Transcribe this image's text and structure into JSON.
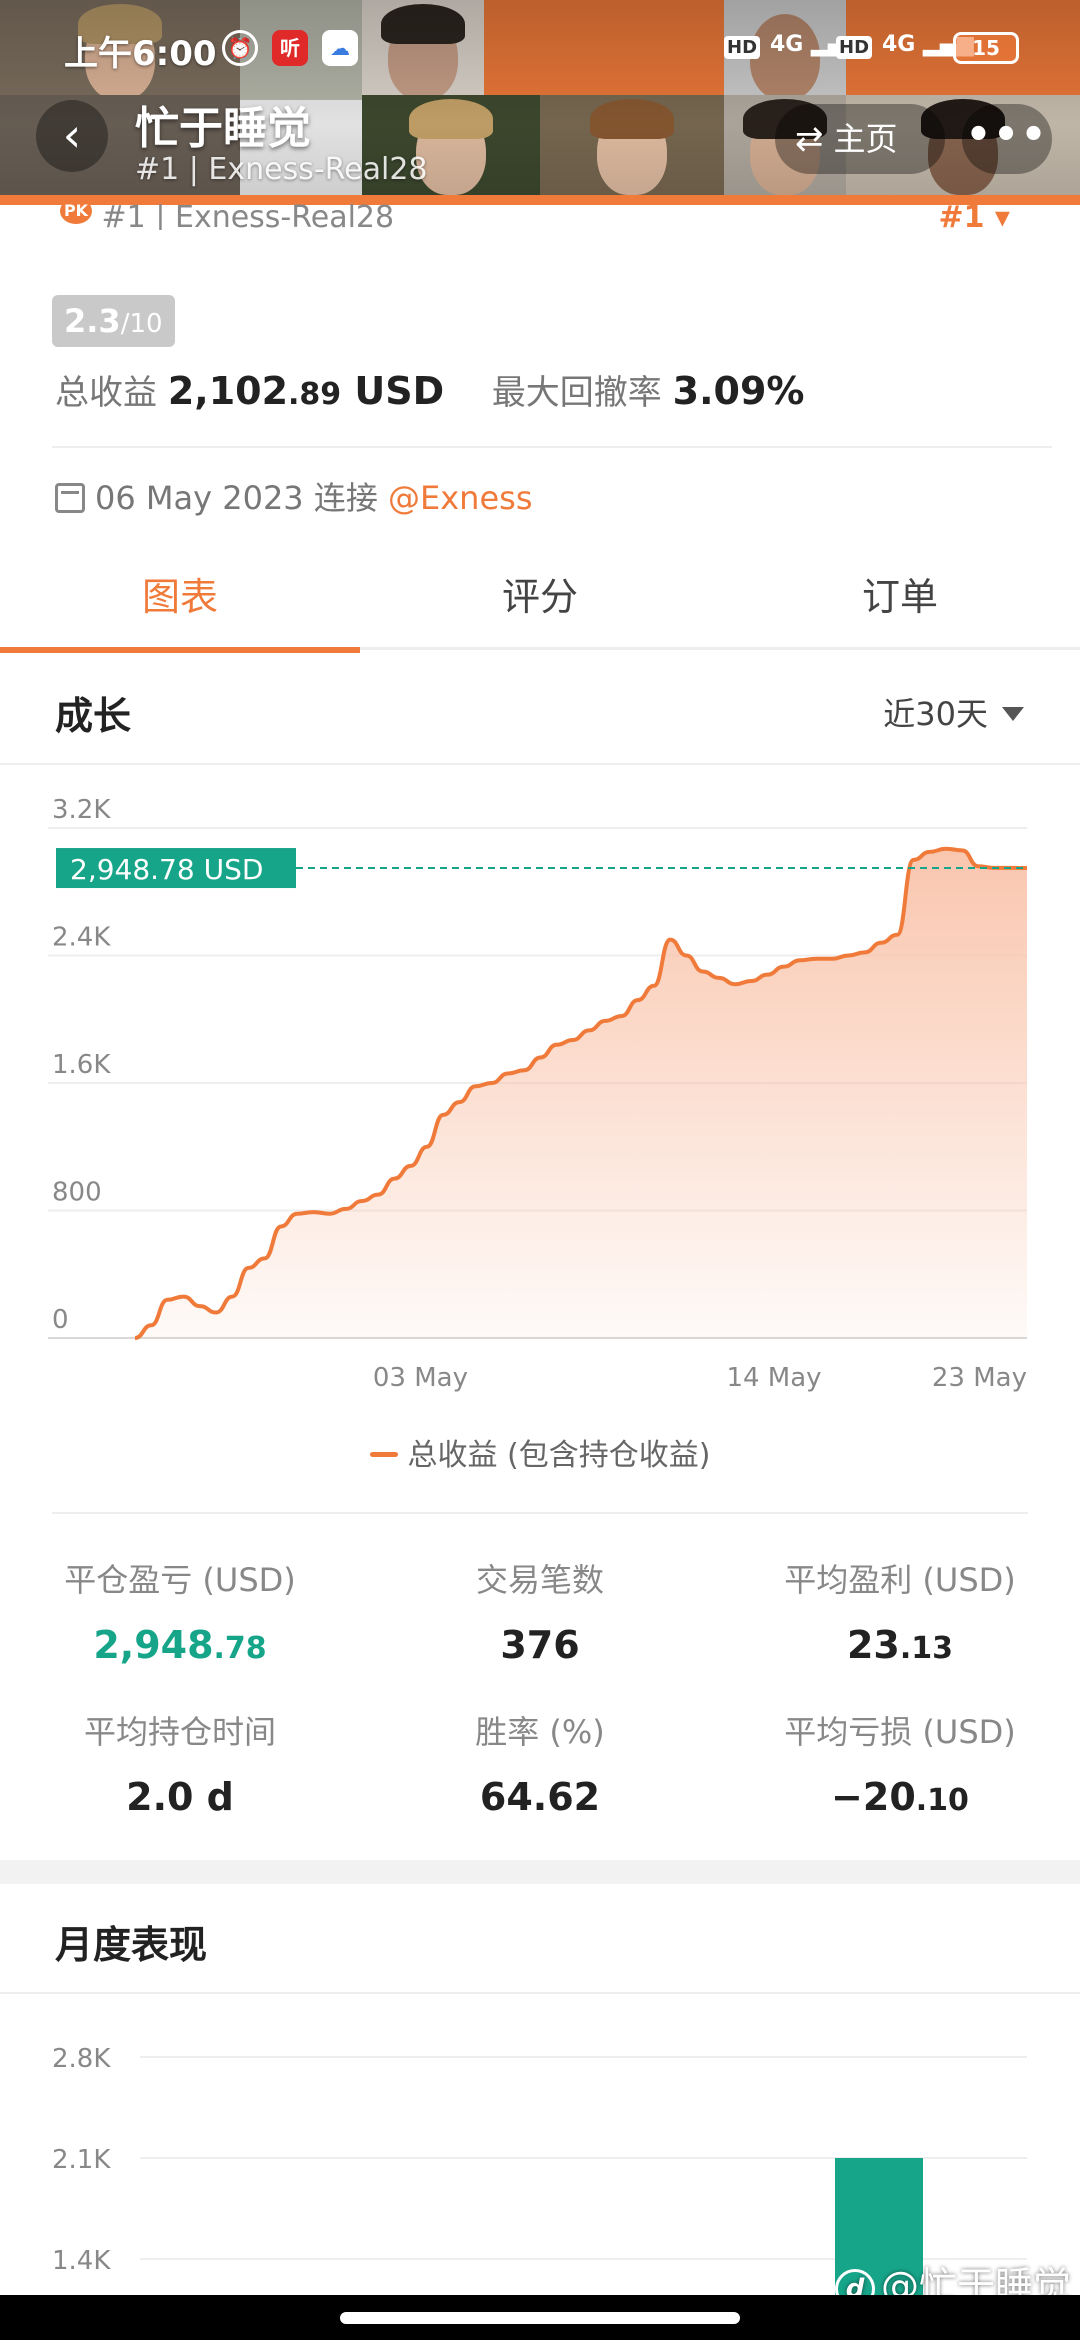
{
  "status_bar": {
    "time": "上午6:00",
    "hd1": "HD",
    "net1": "4G",
    "hd2": "HD",
    "net2": "4G",
    "battery": "15",
    "app_badge": "听"
  },
  "header": {
    "title": "忙于睡觉",
    "subtitle": "#1 | Exness-Real28",
    "home_label": "主页",
    "more_label": "•••"
  },
  "strip": {
    "pk": "PK",
    "rank": "#1",
    "sep": "|",
    "account": "Exness-Real28",
    "rank_right": "#1"
  },
  "summary": {
    "score": "2.3",
    "score_max": "/10",
    "profit_label": "总收益",
    "profit_int": "2,102",
    "profit_dec": ".89",
    "profit_unit": "USD",
    "drawdown_label": "最大回撤率",
    "drawdown_value": "3.09%"
  },
  "connection": {
    "date": "06 May 2023",
    "text": "连接",
    "broker": "@Exness"
  },
  "tabs": [
    {
      "label": "图表"
    },
    {
      "label": "评分"
    },
    {
      "label": "订单"
    }
  ],
  "growth": {
    "title": "成长",
    "range": "近30天"
  },
  "chart_data": {
    "type": "area",
    "y_ticks": [
      "0",
      "800",
      "1.6K",
      "2.4K",
      "3.2K"
    ],
    "ylim": [
      0,
      3200
    ],
    "x_ticks": [
      {
        "label": "03 May",
        "x": 8.8
      },
      {
        "label": "14 May",
        "x": 19.7
      },
      {
        "label": "23 May",
        "x": 29.0
      }
    ],
    "current_label": "2,948.78 USD",
    "current_value": 2948.78,
    "legend": "总收益 (包含持仓收益)",
    "series": [
      {
        "name": "总收益 (包含持仓收益)",
        "points": [
          [
            0.0,
            0
          ],
          [
            0.5,
            80
          ],
          [
            1.0,
            240
          ],
          [
            1.5,
            260
          ],
          [
            2.0,
            200
          ],
          [
            2.5,
            160
          ],
          [
            3.0,
            260
          ],
          [
            3.5,
            440
          ],
          [
            4.0,
            500
          ],
          [
            4.5,
            700
          ],
          [
            5.0,
            780
          ],
          [
            5.5,
            790
          ],
          [
            6.0,
            780
          ],
          [
            6.5,
            810
          ],
          [
            7.0,
            860
          ],
          [
            7.5,
            900
          ],
          [
            8.0,
            1000
          ],
          [
            8.5,
            1080
          ],
          [
            9.0,
            1200
          ],
          [
            9.5,
            1400
          ],
          [
            10.0,
            1480
          ],
          [
            10.5,
            1580
          ],
          [
            11.0,
            1600
          ],
          [
            11.5,
            1660
          ],
          [
            12.0,
            1680
          ],
          [
            12.5,
            1760
          ],
          [
            13.0,
            1840
          ],
          [
            13.5,
            1870
          ],
          [
            14.0,
            1930
          ],
          [
            14.5,
            1990
          ],
          [
            15.0,
            2020
          ],
          [
            15.5,
            2120
          ],
          [
            16.0,
            2210
          ],
          [
            16.5,
            2500
          ],
          [
            17.0,
            2400
          ],
          [
            17.5,
            2300
          ],
          [
            18.0,
            2260
          ],
          [
            18.5,
            2220
          ],
          [
            19.0,
            2240
          ],
          [
            19.5,
            2280
          ],
          [
            20.0,
            2330
          ],
          [
            20.5,
            2370
          ],
          [
            21.0,
            2380
          ],
          [
            21.5,
            2380
          ],
          [
            22.0,
            2400
          ],
          [
            22.5,
            2420
          ],
          [
            23.0,
            2480
          ],
          [
            23.5,
            2530
          ],
          [
            24.0,
            3000
          ],
          [
            24.5,
            3050
          ],
          [
            25.0,
            3070
          ],
          [
            25.5,
            3060
          ],
          [
            26.0,
            2960
          ],
          [
            26.5,
            2950
          ],
          [
            27.0,
            2950
          ],
          [
            27.5,
            2948.78
          ]
        ]
      }
    ],
    "xlim": [
      0,
      27.5
    ],
    "grid": true,
    "colors": {
      "line": "#f07a3a",
      "fill": "#f9c3aa",
      "label_bg": "#17a58a",
      "dash": "#17a58a"
    }
  },
  "stats": [
    {
      "label": "平仓盈亏 (USD)",
      "int": "2,948",
      "dec": ".78",
      "green": true
    },
    {
      "label": "交易笔数",
      "int": "376",
      "dec": "",
      "green": false
    },
    {
      "label": "平均盈利 (USD)",
      "int": "23",
      "dec": ".13",
      "green": false
    },
    {
      "label": "平均持仓时间",
      "int": "2.0 d",
      "dec": "",
      "green": false
    },
    {
      "label": "胜率 (%)",
      "int": "64.62",
      "dec": "",
      "green": false
    },
    {
      "label": "平均亏损 (USD)",
      "int": "−20",
      "dec": ".10",
      "green": false
    }
  ],
  "monthly": {
    "title": "月度表现",
    "y_ticks": [
      "2.8K",
      "2.1K",
      "1.4K"
    ],
    "bar_color": "#17a58a",
    "bar_value": 2100
  },
  "watermark": "@忙于睡觉"
}
